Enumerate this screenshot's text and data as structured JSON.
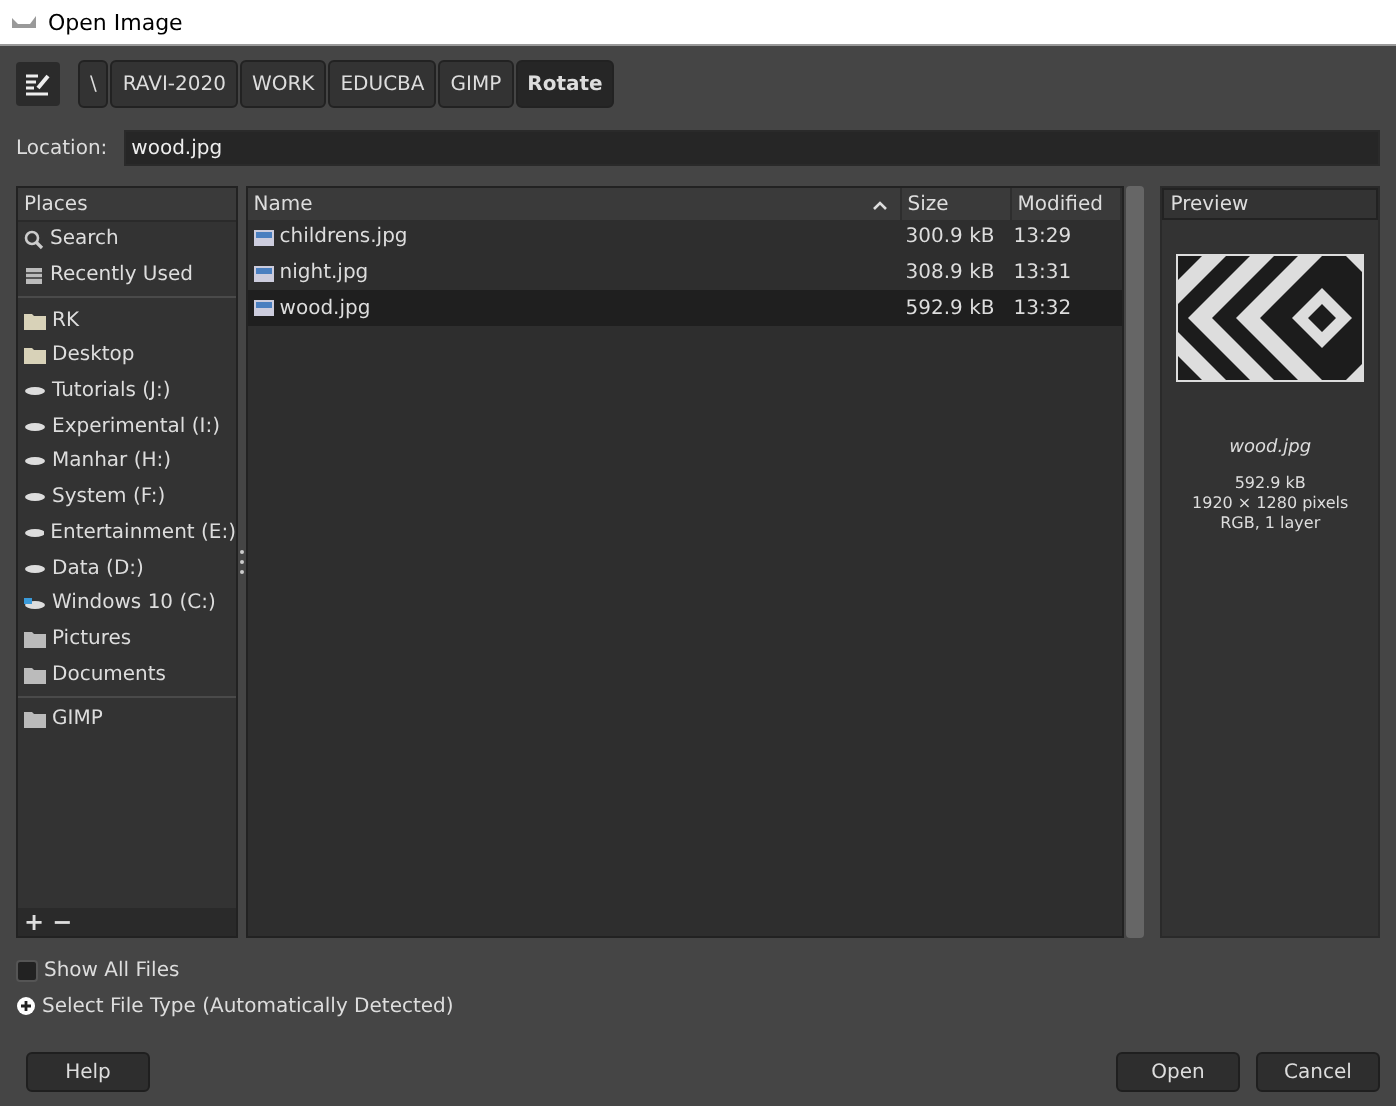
{
  "window": {
    "title": "Open Image"
  },
  "path_bar": [
    {
      "label": "\\",
      "selected": false
    },
    {
      "label": "RAVI-2020",
      "selected": false
    },
    {
      "label": "WORK",
      "selected": false
    },
    {
      "label": "EDUCBA",
      "selected": false
    },
    {
      "label": "GIMP",
      "selected": false
    },
    {
      "label": "Rotate",
      "selected": true
    }
  ],
  "location": {
    "label": "Location:",
    "value": "wood.jpg"
  },
  "places": {
    "title": "Places",
    "groups": [
      [
        {
          "kind": "search",
          "label": "Search"
        },
        {
          "kind": "recent",
          "label": "Recently Used"
        }
      ],
      [
        {
          "kind": "folder",
          "label": "RK"
        },
        {
          "kind": "folder",
          "label": "Desktop"
        },
        {
          "kind": "drive",
          "label": "Tutorials (J:)"
        },
        {
          "kind": "drive",
          "label": "Experimental (I:)"
        },
        {
          "kind": "drive",
          "label": "Manhar (H:)"
        },
        {
          "kind": "drive",
          "label": "System (F:)"
        },
        {
          "kind": "drive",
          "label": "Entertainment (E:)"
        },
        {
          "kind": "drive",
          "label": "Data (D:)"
        },
        {
          "kind": "windows",
          "label": "Windows 10 (C:)"
        },
        {
          "kind": "library",
          "label": "Pictures"
        },
        {
          "kind": "library",
          "label": "Documents"
        }
      ],
      [
        {
          "kind": "library",
          "label": "GIMP"
        }
      ]
    ],
    "add_button": "+",
    "remove_button": "−"
  },
  "files": {
    "columns": [
      "Name",
      "Size",
      "Modified"
    ],
    "rows": [
      {
        "name": "childrens.jpg",
        "size": "300.9 kB",
        "modified": "13:29",
        "selected": false
      },
      {
        "name": "night.jpg",
        "size": "308.9 kB",
        "modified": "13:31",
        "selected": false
      },
      {
        "name": "wood.jpg",
        "size": "592.9 kB",
        "modified": "13:32",
        "selected": true
      }
    ]
  },
  "preview": {
    "title": "Preview",
    "filename": "wood.jpg",
    "size": "592.9 kB",
    "dimensions": "1920 × 1280 pixels",
    "info": "RGB, 1 layer"
  },
  "options": [
    {
      "kind": "checkbox",
      "label": "Show All Files",
      "checked": false
    },
    {
      "kind": "expander",
      "label": "Select File Type (Automatically Detected)",
      "expanded": false
    }
  ],
  "buttons": {
    "help": "Help",
    "open": "Open",
    "cancel": "Cancel"
  }
}
